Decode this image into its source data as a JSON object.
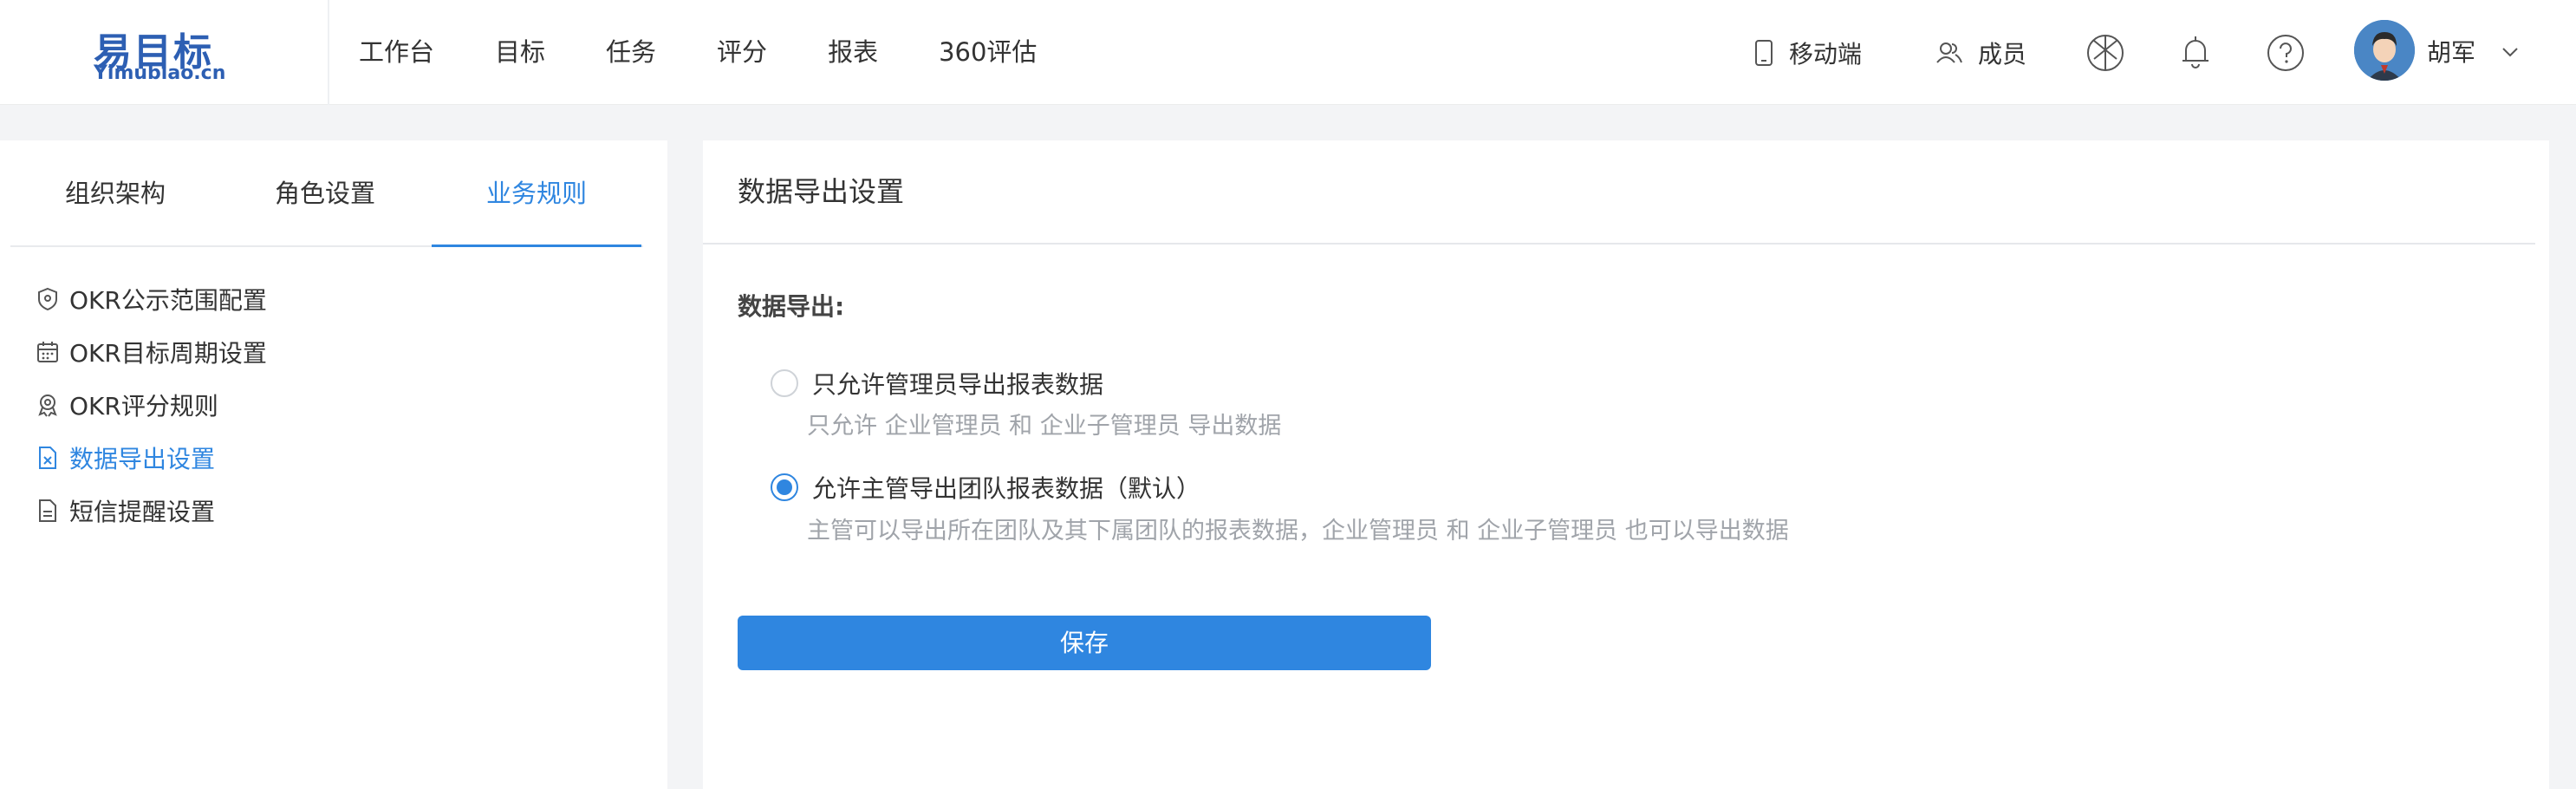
{
  "logo": {
    "cn": "易目标",
    "en": "Yimubiao.cn"
  },
  "nav": {
    "items": [
      "工作台",
      "目标",
      "任务",
      "评分",
      "报表",
      "360评估"
    ],
    "mobile_label": "移动端",
    "members_label": "成员",
    "icons": [
      "aperture-icon",
      "bell-icon",
      "help-icon"
    ],
    "user_name": "胡军"
  },
  "left": {
    "tabs": [
      "组织架构",
      "角色设置",
      "业务规则"
    ],
    "active_tab": "业务规则",
    "menu": [
      {
        "label": "OKR公示范围配置",
        "icon": "shield-icon"
      },
      {
        "label": "OKR目标周期设置",
        "icon": "calendar-icon"
      },
      {
        "label": "OKR评分规则",
        "icon": "badge-icon"
      },
      {
        "label": "数据导出设置",
        "icon": "export-file-icon",
        "active": true
      },
      {
        "label": "短信提醒设置",
        "icon": "document-icon"
      }
    ]
  },
  "main": {
    "title": "数据导出设置",
    "section_label": "数据导出:",
    "options": [
      {
        "label": "只允许管理员导出报表数据",
        "desc": "只允许 企业管理员 和 企业子管理员 导出数据",
        "checked": false
      },
      {
        "label": "允许主管导出团队报表数据（默认）",
        "desc": "主管可以导出所在团队及其下属团队的报表数据，企业管理员 和 企业子管理员 也可以导出数据",
        "checked": true
      }
    ],
    "save_label": "保存"
  },
  "colors": {
    "accent": "#2f86e0",
    "brand": "#2d5fb3"
  }
}
